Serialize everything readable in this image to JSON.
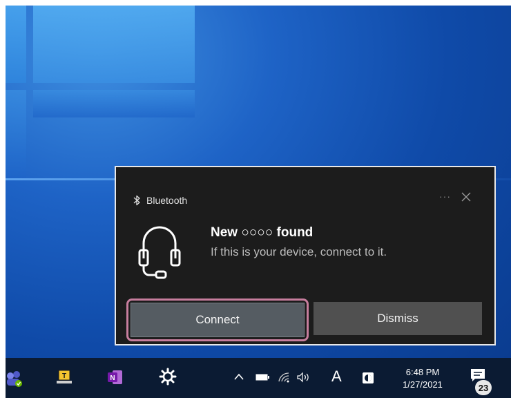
{
  "toast": {
    "app_name": "Bluetooth",
    "more_label": "···",
    "title": "New ○○○○ found",
    "body": "If this is your device, connect to it.",
    "connect_label": "Connect",
    "dismiss_label": "Dismiss"
  },
  "icons": {
    "app": "bluetooth-icon",
    "device": "headset-icon",
    "more": "more-icon",
    "close": "close-icon"
  },
  "taskbar": {
    "pinned": [
      "teams-icon",
      "notebook-icon",
      "onenote-icon",
      "settings-icon"
    ],
    "tray": [
      "chevron-up-icon",
      "battery-icon",
      "wifi-icon",
      "volume-icon",
      "security-icon"
    ],
    "ime_label": "A",
    "clock_time": "6:48 PM",
    "clock_date": "1/27/2021",
    "notification_count": "23"
  },
  "colors": {
    "toast_bg": "#1c1c1c",
    "connect_highlight": "#c77e9e",
    "taskbar_bg": "#0b1b33",
    "desktop_blue": "#1e63c6"
  }
}
